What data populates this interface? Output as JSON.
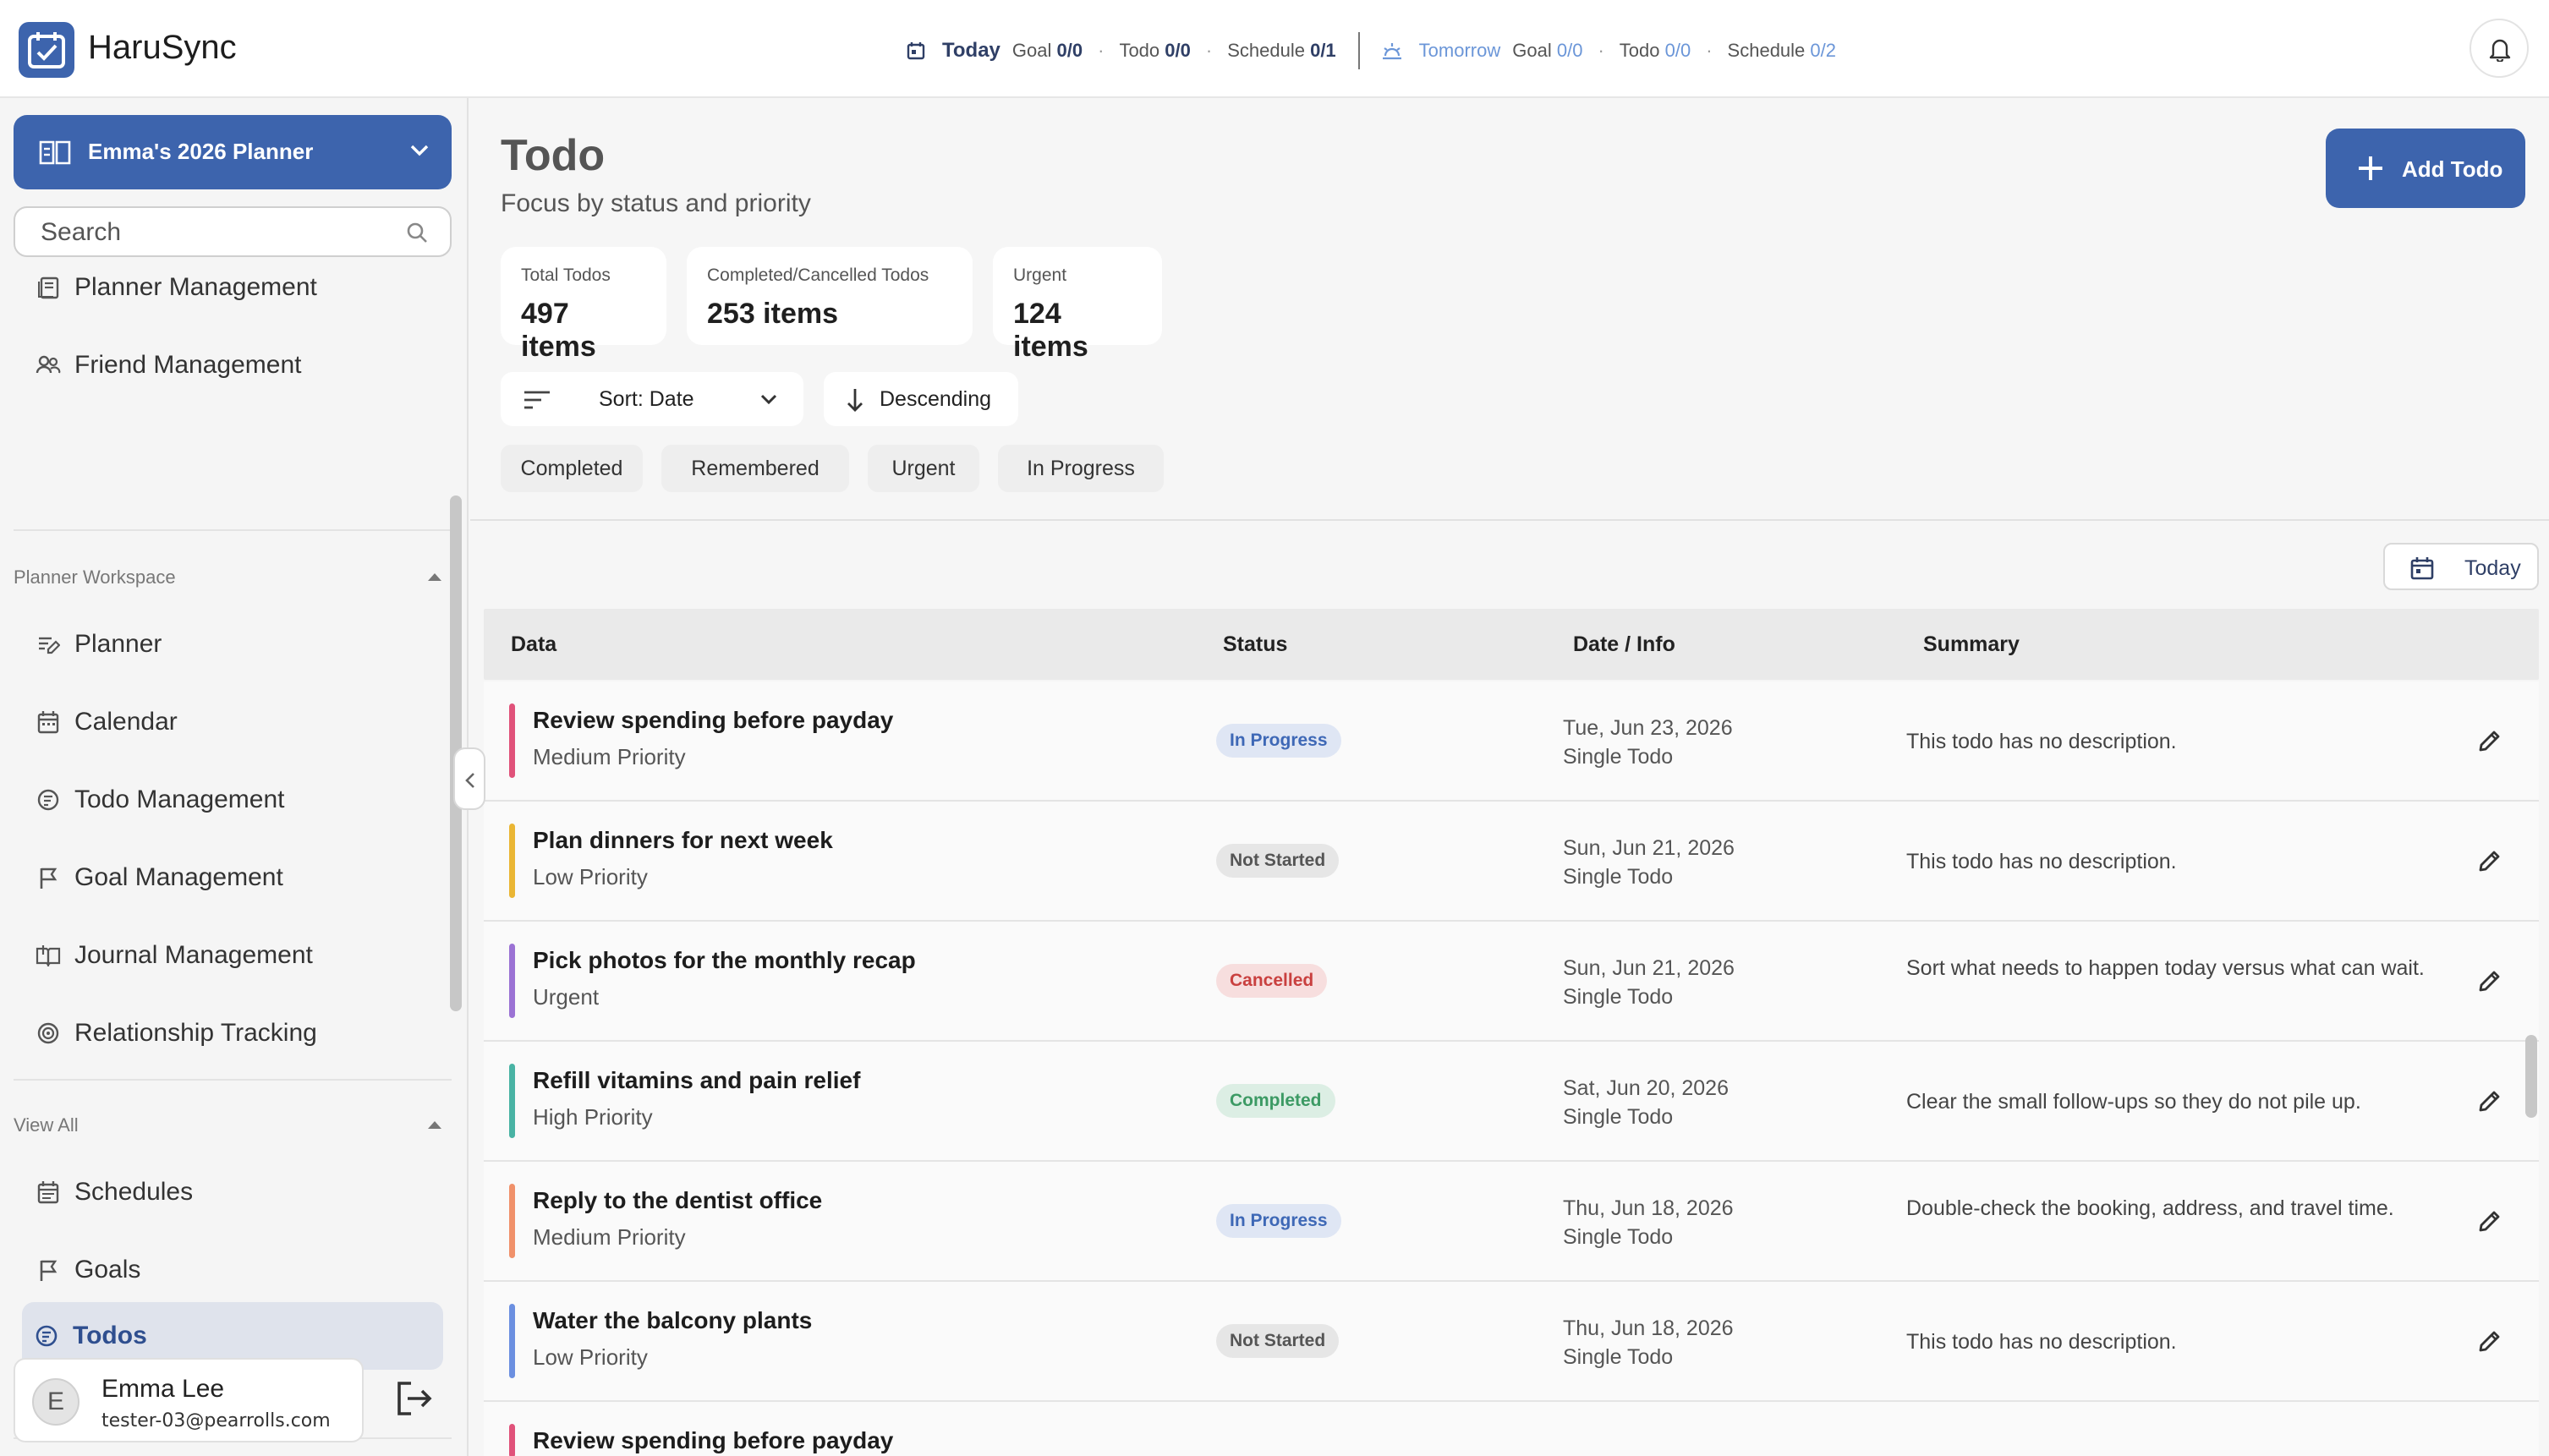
{
  "app": {
    "name": "HaruSync"
  },
  "header_summary": {
    "today_label": "Today",
    "today_goal_label": "Goal",
    "today_goal": "0/0",
    "today_todo_label": "Todo",
    "today_todo": "0/0",
    "today_schedule_label": "Schedule",
    "today_schedule": "0/1",
    "tomorrow_label": "Tomorrow",
    "tomorrow_goal_label": "Goal",
    "tomorrow_goal": "0/0",
    "tomorrow_todo_label": "Todo",
    "tomorrow_todo": "0/0",
    "tomorrow_schedule_label": "Schedule",
    "tomorrow_schedule": "0/2"
  },
  "sidebar": {
    "planner_name": "Emma's 2026 Planner",
    "search_placeholder": "Search",
    "top_items": [
      {
        "label": "Planner Management"
      },
      {
        "label": "Friend Management"
      }
    ],
    "workspace_label": "Planner Workspace",
    "workspace_items": [
      {
        "label": "Planner"
      },
      {
        "label": "Calendar"
      },
      {
        "label": "Todo Management"
      },
      {
        "label": "Goal Management"
      },
      {
        "label": "Journal Management"
      },
      {
        "label": "Relationship Tracking"
      }
    ],
    "viewall_label": "View All",
    "viewall_items": [
      {
        "label": "Schedules"
      },
      {
        "label": "Goals"
      },
      {
        "label": "Todos"
      }
    ],
    "user": {
      "initial": "E",
      "name": "Emma Lee",
      "email": "tester-03@pearrolls.com"
    }
  },
  "main": {
    "title": "Todo",
    "subtitle": "Focus by status and priority",
    "add_label": "Add Todo",
    "stats": [
      {
        "label": "Total Todos",
        "value": "497 items"
      },
      {
        "label": "Completed/Cancelled Todos",
        "value": "253 items"
      },
      {
        "label": "Urgent",
        "value": "124 items"
      }
    ],
    "sort_label": "Sort: Date",
    "direction_label": "Descending",
    "filters": [
      "Completed",
      "Remembered",
      "Urgent",
      "In Progress"
    ],
    "today_button": "Today",
    "columns": {
      "data": "Data",
      "status": "Status",
      "date": "Date / Info",
      "summary": "Summary"
    },
    "rows": [
      {
        "title": "Review spending before payday",
        "priority": "Medium Priority",
        "status": "In Progress",
        "date": "Tue, Jun 23, 2026",
        "type": "Single Todo",
        "summary": "This todo has no description.",
        "color": "#e0527a"
      },
      {
        "title": "Plan dinners for next week",
        "priority": "Low Priority",
        "status": "Not Started",
        "date": "Sun, Jun 21, 2026",
        "type": "Single Todo",
        "summary": "This todo has no description.",
        "color": "#eab634"
      },
      {
        "title": "Pick photos for the monthly recap",
        "priority": "Urgent",
        "status": "Cancelled",
        "date": "Sun, Jun 21, 2026",
        "type": "Single Todo",
        "summary": "Sort what needs to happen today versus what can wait.",
        "color": "#9b72d4"
      },
      {
        "title": "Refill vitamins and pain relief",
        "priority": "High Priority",
        "status": "Completed",
        "date": "Sat, Jun 20, 2026",
        "type": "Single Todo",
        "summary": "Clear the small follow-ups so they do not pile up.",
        "color": "#49b3a4"
      },
      {
        "title": "Reply to the dentist office",
        "priority": "Medium Priority",
        "status": "In Progress",
        "date": "Thu, Jun 18, 2026",
        "type": "Single Todo",
        "summary": "Double-check the booking, address, and travel time.",
        "color": "#f0916a"
      },
      {
        "title": "Water the balcony plants",
        "priority": "Low Priority",
        "status": "Not Started",
        "date": "Thu, Jun 18, 2026",
        "type": "Single Todo",
        "summary": "This todo has no description.",
        "color": "#6b8fe0"
      },
      {
        "title": "Review spending before payday",
        "priority": "",
        "status": "",
        "date": "",
        "type": "",
        "summary": "",
        "color": "#e0527a"
      }
    ]
  }
}
